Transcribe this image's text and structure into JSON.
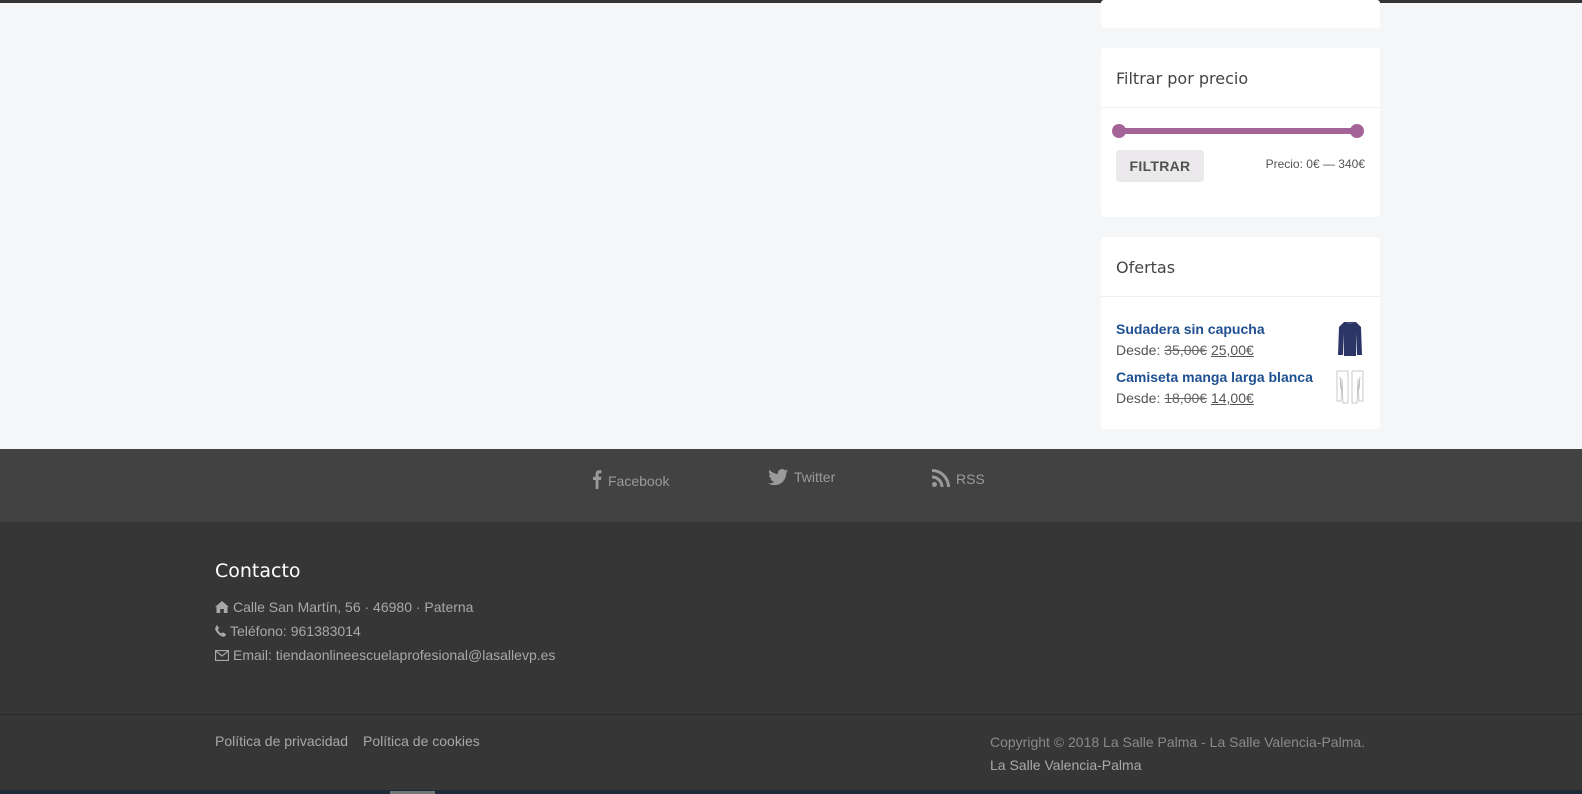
{
  "sidebar": {
    "price_filter": {
      "title": "Filtrar por precio",
      "button_label": "FILTRAR",
      "price_label": "Precio: 0€ — 340€",
      "range_min": 0,
      "range_max": 340,
      "accent_color": "#a46497"
    },
    "offers": {
      "title": "Ofertas",
      "items": [
        {
          "name": "Sudadera sin capucha",
          "prefix": "Desde:",
          "old_price": "35,00€",
          "new_price": "25,00€",
          "thumb_icon": "sweatshirt-thumbnail"
        },
        {
          "name": "Camiseta manga larga blanca",
          "prefix": "Desde:",
          "old_price": "18,00€",
          "new_price": "14,00€",
          "thumb_icon": "long-sleeve-shirt-thumbnail"
        }
      ]
    }
  },
  "social": {
    "links": [
      {
        "label": "Facebook",
        "icon": "facebook-icon"
      },
      {
        "label": "Twitter",
        "icon": "twitter-icon"
      },
      {
        "label": "RSS",
        "icon": "rss-icon"
      }
    ]
  },
  "footer": {
    "title": "Contacto",
    "address": "Calle San Martín, 56 · 46980 · Paterna",
    "phone": "Teléfono: 961383014",
    "email": "Email: tiendaonlineescuelaprofesional@lasallevp.es"
  },
  "bottom": {
    "privacy_link": "Política de privacidad",
    "cookies_link": "Política de cookies",
    "copyright": "Copyright © 2018 La Salle Palma - La Salle Valencia-Palma.",
    "site_link": "La Salle Valencia-Palma"
  },
  "colors": {
    "page_bg": "#f5f6f8",
    "social_bar": "#424242",
    "footer_bg": "#363636",
    "product_link": "#1d4f91"
  }
}
